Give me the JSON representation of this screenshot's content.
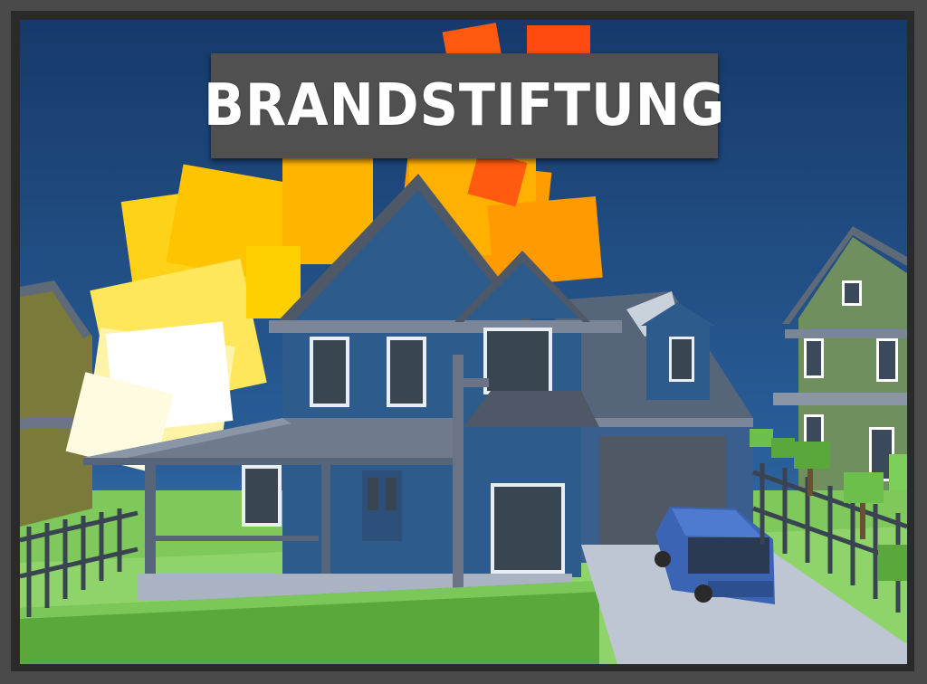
{
  "title": {
    "text": "BRANDSTIFTUNG"
  },
  "colors": {
    "sky": "#1d3f6e",
    "house_main": "#2d5c8c",
    "roof": "#56657a",
    "fire_yellow": "#ffd21a",
    "fire_orange": "#ff8a00",
    "fire_red": "#ff4a10",
    "grass": "#8fd46a",
    "banner": "#505050"
  }
}
